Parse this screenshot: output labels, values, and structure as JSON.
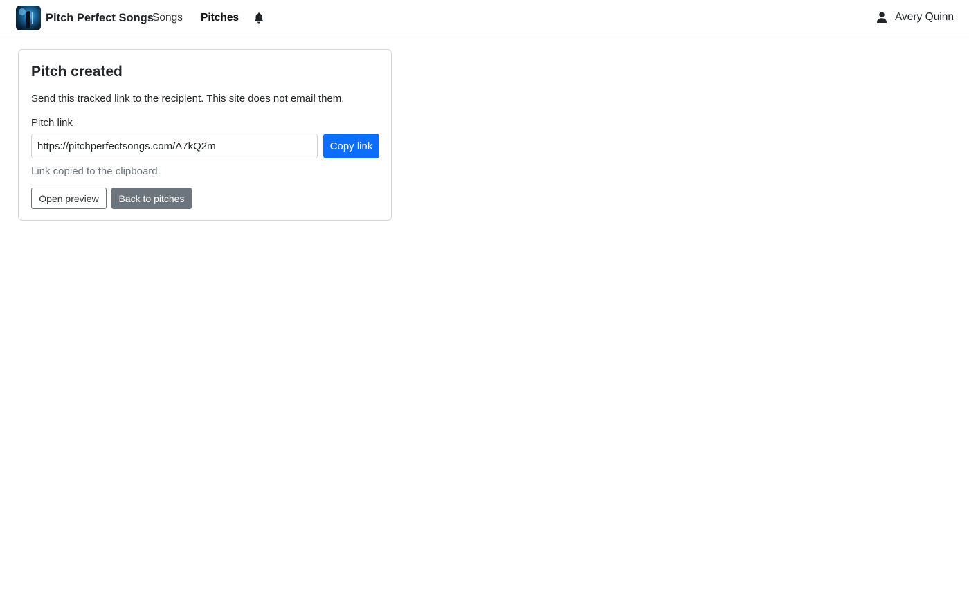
{
  "navbar": {
    "brand_name": "Pitch Perfect Songs",
    "links": [
      {
        "label": "Songs",
        "active": false
      },
      {
        "label": "Pitches",
        "active": true
      }
    ],
    "notification_icon": "bell-icon",
    "user": {
      "name": "Avery Quinn",
      "icon": "user-icon"
    }
  },
  "card": {
    "title": "Pitch created",
    "description": "Send this tracked link to the recipient. This site does not email them.",
    "field_label": "Pitch link",
    "link_value": "https://pitchperfectsongs.com/A7kQ2m",
    "copy_label": "Copy link",
    "copied_message": "Link copied to the clipboard.",
    "preview_label": "Open preview",
    "back_label": "Back to pitches"
  },
  "colors": {
    "primary": "#0d6efd",
    "secondary": "#6c757d",
    "muted_text": "#6c757d",
    "border": "#dee2e6"
  }
}
